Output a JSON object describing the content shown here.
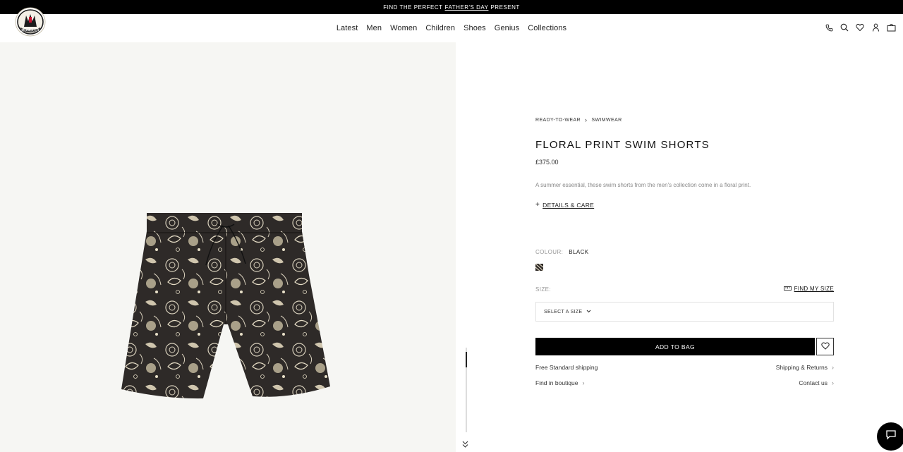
{
  "promo": {
    "before": "FIND THE PERFECT",
    "link": "FATHER'S DAY",
    "after": "PRESENT"
  },
  "header": {
    "logo_text": "MONCLER",
    "nav": [
      "Latest",
      "Men",
      "Women",
      "Children",
      "Shoes",
      "Genius",
      "Collections"
    ],
    "icons": [
      "phone-icon",
      "search-icon",
      "heart-icon",
      "user-icon",
      "bag-icon"
    ]
  },
  "product": {
    "breadcrumb": [
      "READY-TO-WEAR",
      "SWIMWEAR"
    ],
    "title": "FLORAL PRINT SWIM SHORTS",
    "price": "£375.00",
    "description": "A summer essential, these swim shorts from the men's collection come in a floral print.",
    "details_label": "DETAILS & CARE",
    "colour_label": "COLOUR:",
    "colour_value": "BLACK",
    "size_label": "SIZE:",
    "find_size_label": "FIND MY SIZE",
    "size_placeholder": "SELECT A SIZE",
    "add_to_bag": "ADD TO BAG",
    "shipping": "Free Standard shipping",
    "shipping_returns": "Shipping & Returns",
    "boutique": "Find in boutique",
    "contact": "Contact us"
  },
  "colors": {
    "accent": "#000000",
    "media_bg": "#f6f6f3",
    "muted_text": "#999999"
  }
}
